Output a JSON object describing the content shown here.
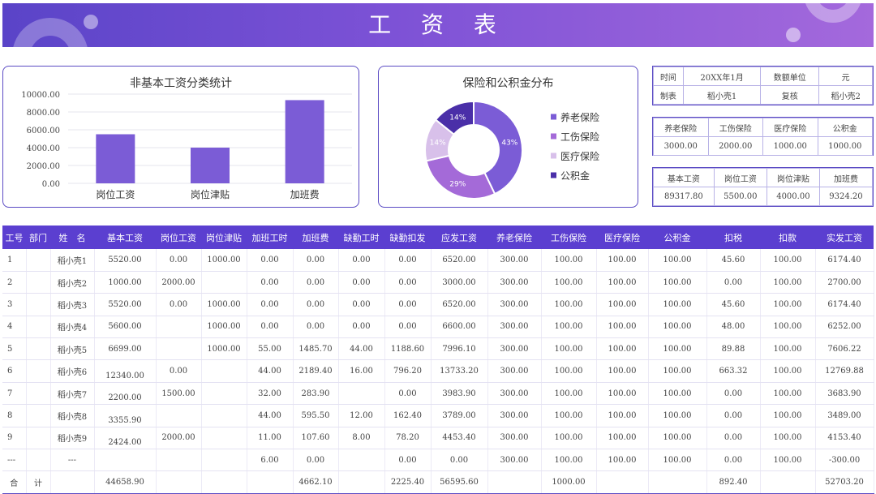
{
  "header": {
    "title": "工 资 表"
  },
  "bar_card": {
    "title": "非基本工资分类统计",
    "chart_data": {
      "type": "bar",
      "title": "非基本工资分类统计",
      "categories": [
        "岗位工资",
        "岗位津贴",
        "加班费"
      ],
      "values": [
        5500,
        4000,
        9324.2
      ],
      "ylim": [
        0,
        10000
      ],
      "yticks": [
        "0.00",
        "2000.00",
        "4000.00",
        "6000.00",
        "8000.00",
        "10000.00"
      ],
      "grid": true,
      "color": "#7b5cd6"
    }
  },
  "pie_card": {
    "title": "保险和公积金分布",
    "chart_data": {
      "type": "pie",
      "title": "保险和公积金分布",
      "labels": [
        "养老保险",
        "工伤保险",
        "医疗保险",
        "公积金"
      ],
      "percent_labels": [
        "43%",
        "29%",
        "14%",
        "14%"
      ],
      "values": [
        3000,
        2000,
        1000,
        1000
      ],
      "colors": [
        "#7b5cd6",
        "#a46ad8",
        "#d8c0ea",
        "#4a2fa8"
      ],
      "legend_position": "right"
    }
  },
  "info1": [
    [
      "时间",
      "20XX年1月",
      "数额单位",
      "元"
    ],
    [
      "制表",
      "稻小壳1",
      "复核",
      "稻小壳2"
    ]
  ],
  "info2": [
    [
      "养老保险",
      "工伤保险",
      "医疗保险",
      "公积金"
    ],
    [
      "3000.00",
      "2000.00",
      "1000.00",
      "1000.00"
    ]
  ],
  "info3": [
    [
      "基本工资",
      "岗位工资",
      "岗位津贴",
      "加班费"
    ],
    [
      "89317.80",
      "5500.00",
      "4000.00",
      "9324.20"
    ]
  ],
  "table": {
    "headers": [
      "工号",
      "部门",
      "姓　名",
      "基本工资",
      "岗位工资",
      "岗位津贴",
      "加班工时",
      "加班费",
      "缺勤工时",
      "缺勤扣发",
      "应发工资",
      "养老保险",
      "工伤保险",
      "医疗保险",
      "公积金",
      "扣税",
      "扣款",
      "实发工资"
    ],
    "rows": [
      [
        "1",
        "",
        "稻小壳1",
        "5520.00",
        "0.00",
        "1000.00",
        "0.00",
        "0.00",
        "0.00",
        "0.00",
        "6520.00",
        "300.00",
        "100.00",
        "100.00",
        "100.00",
        "45.60",
        "100.00",
        "6174.40"
      ],
      [
        "2",
        "",
        "稻小壳2",
        "1000.00",
        "2000.00",
        "",
        "0.00",
        "0.00",
        "0.00",
        "0.00",
        "3000.00",
        "300.00",
        "100.00",
        "100.00",
        "100.00",
        "0.00",
        "100.00",
        "2700.00"
      ],
      [
        "3",
        "",
        "稻小壳3",
        "5520.00",
        "0.00",
        "1000.00",
        "0.00",
        "0.00",
        "0.00",
        "0.00",
        "6520.00",
        "300.00",
        "100.00",
        "100.00",
        "100.00",
        "45.60",
        "100.00",
        "6174.40"
      ],
      [
        "4",
        "",
        "稻小壳4",
        "5600.00",
        "",
        "1000.00",
        "0.00",
        "0.00",
        "0.00",
        "0.00",
        "6600.00",
        "300.00",
        "100.00",
        "100.00",
        "100.00",
        "48.00",
        "100.00",
        "6252.00"
      ],
      [
        "5",
        "",
        "稻小壳5",
        "6699.00",
        "",
        "1000.00",
        "55.00",
        "1485.70",
        "44.00",
        "1188.60",
        "7996.10",
        "300.00",
        "100.00",
        "100.00",
        "100.00",
        "89.88",
        "100.00",
        "7606.22"
      ],
      [
        "6",
        "",
        "稻小壳6",
        "12340.00",
        "0.00",
        "",
        "44.00",
        "2189.40",
        "16.00",
        "796.20",
        "13733.20",
        "300.00",
        "100.00",
        "100.00",
        "100.00",
        "663.32",
        "100.00",
        "12769.88"
      ],
      [
        "7",
        "",
        "稻小壳7",
        "2200.00",
        "1500.00",
        "",
        "32.00",
        "283.90",
        "",
        "0.00",
        "3983.90",
        "300.00",
        "100.00",
        "100.00",
        "100.00",
        "0.00",
        "100.00",
        "3683.90"
      ],
      [
        "8",
        "",
        "稻小壳8",
        "3355.90",
        "",
        "",
        "44.00",
        "595.50",
        "12.00",
        "162.40",
        "3789.00",
        "300.00",
        "100.00",
        "100.00",
        "100.00",
        "0.00",
        "100.00",
        "3489.00"
      ],
      [
        "9",
        "",
        "稻小壳9",
        "2424.00",
        "2000.00",
        "",
        "11.00",
        "107.60",
        "8.00",
        "78.20",
        "4453.40",
        "300.00",
        "100.00",
        "100.00",
        "100.00",
        "0.00",
        "100.00",
        "4153.40"
      ],
      [
        "---",
        "",
        "---",
        "",
        "",
        "",
        "6.00",
        "0.00",
        "",
        "0.00",
        "0.00",
        "300.00",
        "100.00",
        "100.00",
        "100.00",
        "0.00",
        "100.00",
        "-300.00"
      ]
    ],
    "total": [
      "合",
      "计",
      "",
      "44658.90",
      "",
      "",
      "",
      "4662.10",
      "",
      "2225.40",
      "56595.60",
      "",
      "1000.00",
      "",
      "",
      "892.40",
      "",
      "52703.20"
    ]
  }
}
